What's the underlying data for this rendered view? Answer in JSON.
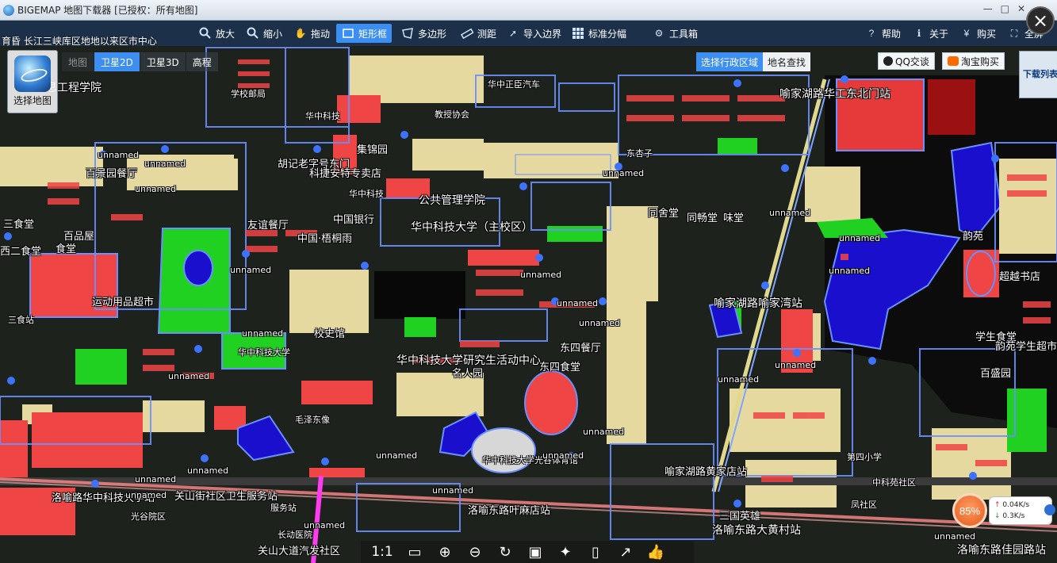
{
  "window": {
    "title": "BIGEMAP 地图下载器 [已授权：所有地图]",
    "minimize": "—",
    "restore": "□",
    "close": "✕"
  },
  "breadcrumb": "育昏 长江三峡库区地地以来区市中心",
  "toolbar": {
    "items": [
      {
        "label": "放大",
        "icon": "zoom-in-icon"
      },
      {
        "label": "缩小",
        "icon": "zoom-out-icon"
      },
      {
        "label": "拖动",
        "icon": "hand-icon"
      },
      {
        "label": "矩形框",
        "icon": "rectangle-icon",
        "active": true
      },
      {
        "label": "多边形",
        "icon": "polygon-icon"
      },
      {
        "label": "测距",
        "icon": "ruler-icon"
      },
      {
        "label": "导入边界",
        "icon": "import-icon"
      },
      {
        "label": "标准分幅",
        "icon": "grid-icon"
      },
      {
        "label": "工具箱",
        "icon": "gear-icon"
      },
      {
        "label": "帮助",
        "icon": "help-icon"
      },
      {
        "label": "关于",
        "icon": "about-icon"
      },
      {
        "label": "购买",
        "icon": "buy-icon"
      },
      {
        "label": "全屏",
        "icon": "fullscreen-icon"
      }
    ]
  },
  "map_selector": {
    "label": "选择地图"
  },
  "map_types": [
    {
      "label": "地图"
    },
    {
      "label": "卫星2D",
      "active": true
    },
    {
      "label": "卫星3D"
    },
    {
      "label": "高程"
    }
  ],
  "search_tabs": [
    {
      "label": "选择行政区域",
      "active": true
    },
    {
      "label": "地名查找"
    }
  ],
  "qq_button": "QQ交谈",
  "shop_button": "淘宝购买",
  "download_list": "下载列表",
  "speed": {
    "percent": "85%",
    "upload": "0.04K/s",
    "download": "0.3K/s",
    "up_arrow": "↑",
    "down_arrow": "↓"
  },
  "bottom_bar": {
    "zoom_label": "1:1"
  },
  "map_labels": [
    "息工程学院",
    "华中科技",
    "学校邮局",
    "教授协会",
    "华中正臣汽车",
    "华中科技",
    "喻家湖路华工东北门站",
    "集锦园",
    "胡记老字号东门",
    "科捷安特专卖店",
    "公共管理学院",
    "中国银行",
    "友谊餐厅",
    "中国·梧桐雨",
    "华中科技大学（主校区）",
    "同舍堂",
    "同畅堂",
    "味堂",
    "三食堂",
    "百品屋",
    "西二食堂",
    "食堂",
    "运动用品超市",
    "百景园餐厅",
    "校史馆",
    "华中科技大学研究生活动中心",
    "东四餐厅",
    "东四食堂",
    "名人园",
    "喻家湖路喻家湾站",
    "超越书店",
    "韵苑",
    "学生食堂",
    "韵苑学生超市",
    "百盛园",
    "华中科技大学光谷体育馆",
    "喻家湖路黄家店站",
    "华中科技大学",
    "洛喻路华中科技大学站",
    "关山街社区卫生服务站",
    "洛喻东路叶麻店站",
    "三国英雄",
    "洛喻东路大黄村站",
    "洛喻东路佳园路站",
    "光谷院区",
    "关山大道汽发社区",
    "毛泽东像",
    "服务站",
    "第四小学",
    "凤社区",
    "长动医院",
    "中科苑社区",
    "东杏子",
    "三食站"
  ],
  "map_generic_label": "unnamed"
}
